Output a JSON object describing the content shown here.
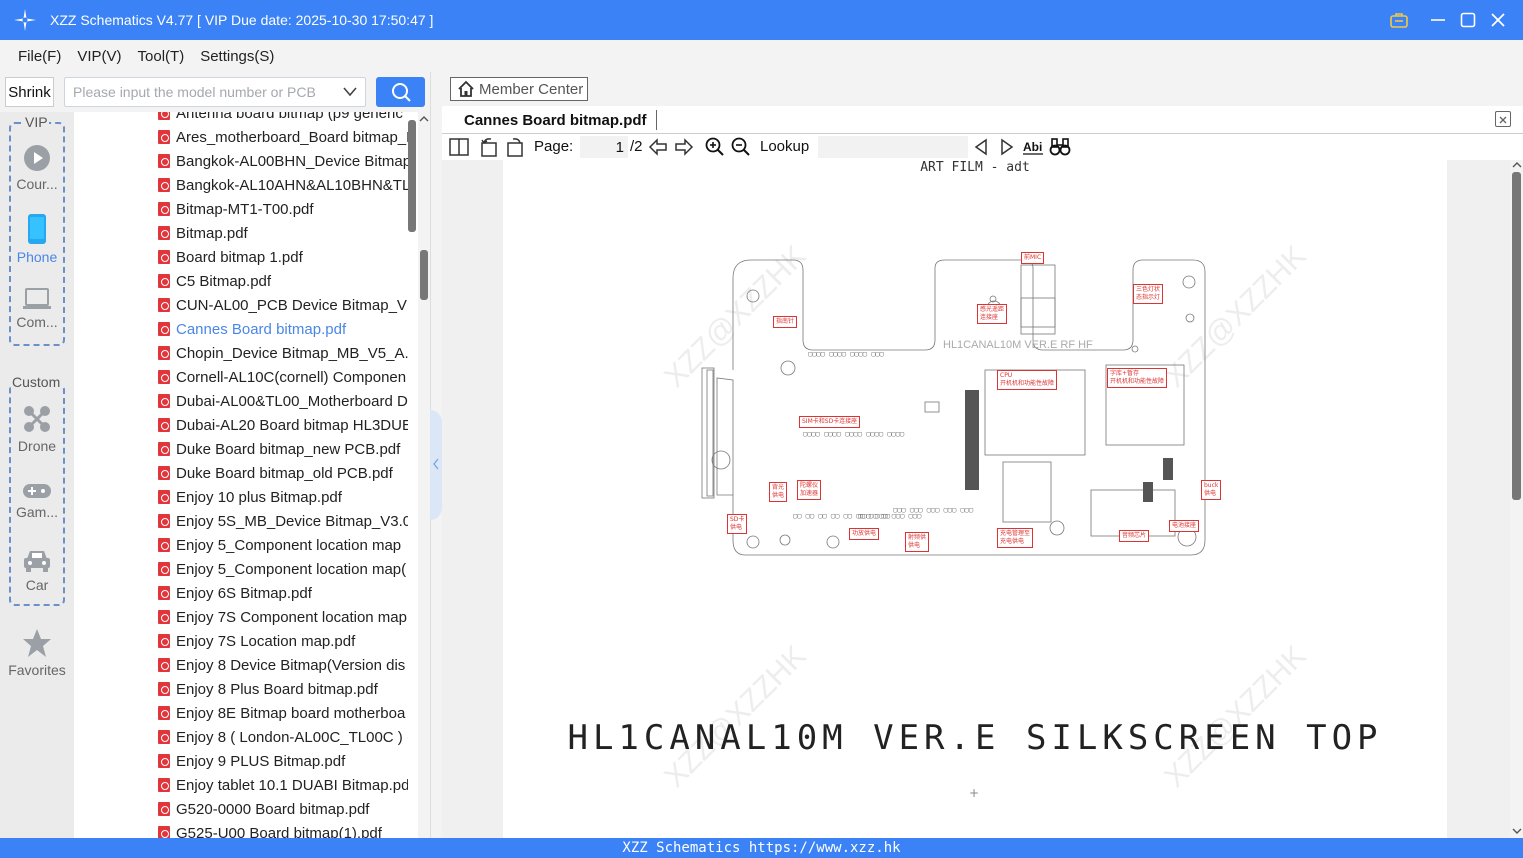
{
  "app": {
    "title": "XZZ Schematics V4.77 [ VIP Due date: 2025-10-30 17:50:47 ]",
    "accent": "#3a82f6"
  },
  "menu": [
    "File(F)",
    "VIP(V)",
    "Tool(T)",
    "Settings(S)"
  ],
  "search": {
    "shrink_label": "Shrink",
    "placeholder": "Please input the model number or PCB"
  },
  "sidebar": {
    "vip_label": "VIP",
    "custom_label": "Custom",
    "vip_items": [
      {
        "label": "Cour...",
        "icon": "play-icon"
      },
      {
        "label": "Phone",
        "icon": "phone-icon"
      },
      {
        "label": "Com...",
        "icon": "laptop-icon"
      }
    ],
    "custom_items": [
      {
        "label": "Drone",
        "icon": "drone-icon"
      },
      {
        "label": "Gam...",
        "icon": "gamepad-icon"
      },
      {
        "label": "Car",
        "icon": "car-icon"
      }
    ],
    "favorites_label": "Favorites"
  },
  "files": [
    "Antenna board bitmap (p9 generic",
    "Ares_motherboard_Board bitmap_H",
    "Bangkok-AL00BHN_Device Bitmap",
    "Bangkok-AL10AHN&AL10BHN&TL",
    "Bitmap-MT1-T00.pdf",
    "Bitmap.pdf",
    "Board bitmap 1.pdf",
    "C5 Bitmap.pdf",
    "CUN-AL00_PCB Device Bitmap_V1.0",
    "Cannes Board bitmap.pdf",
    "Chopin_Device Bitmap_MB_V5_A.p",
    "Cornell-AL10C(cornell) Componen",
    "Dubai-AL00&TL00_Motherboard D",
    "Dubai-AL20 Board bitmap HL3DUE",
    "Duke Board bitmap_new PCB.pdf",
    "Duke Board bitmap_old PCB.pdf",
    "Enjoy 10 plus Bitmap.pdf",
    "Enjoy 5S_MB_Device Bitmap_V3.01",
    "Enjoy 5_Component location map",
    "Enjoy 5_Component location map(",
    "Enjoy 6S Bitmap.pdf",
    "Enjoy 7S Component location map",
    "Enjoy 7S Location map.pdf",
    "Enjoy 8 Device Bitmap(Version dis",
    "Enjoy 8 Plus Board bitmap.pdf",
    "Enjoy 8E Bitmap board motherboa",
    "Enjoy 8 ( London-AL00C_TL00C ) (",
    "Enjoy 9 PLUS Bitmap.pdf",
    "Enjoy tablet 10.1 DUABI Bitmap.pd",
    "G520-0000 Board bitmap.pdf",
    "G525-U00 Board bitmap(1).pdf"
  ],
  "active_file_index": 9,
  "viewer": {
    "member_center": "Member Center",
    "tab_title": "Cannes Board bitmap.pdf",
    "page_label": "Page:",
    "page_current": "1",
    "page_total": "/2",
    "lookup_label": "Lookup"
  },
  "document": {
    "header": "ART FILM - adt",
    "board_label": "HL1CANAL10M VER.E RF HF",
    "big_title": "HL1CANAL10M VER.E SILKSCREEN TOP",
    "watermark": "XZZ@XZZHK",
    "annotations": [
      "前MIC",
      "感光遥距\n连接座",
      "三色灯状\n态指示灯",
      "指南针",
      "CPU\n开机机和功能性故障",
      "字库+暂存\n开机机和功能性故障",
      "SIM卡和SD卡连接座",
      "背光\n供电",
      "陀螺仪\n加速器",
      "SD卡\n供电",
      "功放供电",
      "射频供\n供电",
      "充电管理至\n充电供电",
      "音频芯片",
      "电池接座",
      "buck\n供电"
    ]
  },
  "status": {
    "text": "XZZ Schematics https://www.xzz.hk"
  }
}
